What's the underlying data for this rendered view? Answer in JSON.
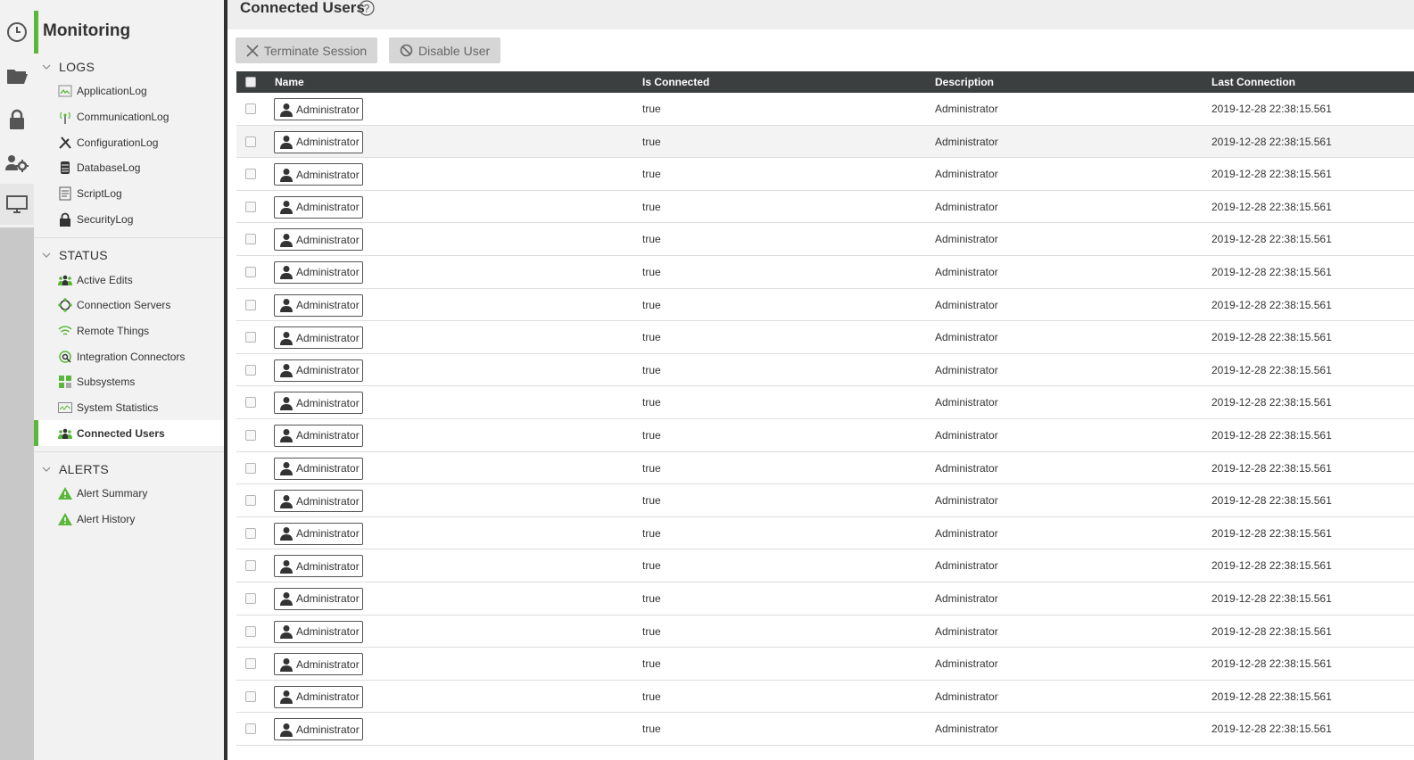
{
  "rail": {
    "icons": [
      "clock-icon",
      "folder-icon",
      "lock-icon",
      "users-gear-icon",
      "monitor-icon"
    ]
  },
  "sidebar": {
    "title": "Monitoring",
    "close": "×",
    "sections": [
      {
        "label": "LOGS",
        "items": [
          {
            "label": "ApplicationLog",
            "icon": "application-log-icon"
          },
          {
            "label": "CommunicationLog",
            "icon": "antenna-icon"
          },
          {
            "label": "ConfigurationLog",
            "icon": "tools-icon"
          },
          {
            "label": "DatabaseLog",
            "icon": "database-icon"
          },
          {
            "label": "ScriptLog",
            "icon": "script-icon"
          },
          {
            "label": "SecurityLog",
            "icon": "lock-icon"
          }
        ]
      },
      {
        "label": "STATUS",
        "items": [
          {
            "label": "Active Edits",
            "icon": "users-icon"
          },
          {
            "label": "Connection Servers",
            "icon": "connection-icon"
          },
          {
            "label": "Remote Things",
            "icon": "wifi-icon"
          },
          {
            "label": "Integration Connectors",
            "icon": "connector-icon"
          },
          {
            "label": "Subsystems",
            "icon": "subsystems-icon"
          },
          {
            "label": "System Statistics",
            "icon": "chart-icon"
          },
          {
            "label": "Connected Users",
            "icon": "users-icon",
            "selected": true
          }
        ]
      },
      {
        "label": "ALERTS",
        "items": [
          {
            "label": "Alert Summary",
            "icon": "warning-icon"
          },
          {
            "label": "Alert History",
            "icon": "warning-icon"
          }
        ]
      }
    ]
  },
  "main": {
    "title": "Connected Users",
    "help": "?",
    "toolbar": {
      "terminate_label": "Terminate Session",
      "disable_label": "Disable User"
    },
    "table": {
      "columns": [
        "Name",
        "Is Connected",
        "Description",
        "Last Connection"
      ],
      "rows": [
        {
          "name": "Administrator",
          "connected": "true",
          "description": "Administrator",
          "last": "2019-12-28 22:38:15.561"
        },
        {
          "name": "Administrator",
          "connected": "true",
          "description": "Administrator",
          "last": "2019-12-28 22:38:15.561"
        },
        {
          "name": "Administrator",
          "connected": "true",
          "description": "Administrator",
          "last": "2019-12-28 22:38:15.561"
        },
        {
          "name": "Administrator",
          "connected": "true",
          "description": "Administrator",
          "last": "2019-12-28 22:38:15.561"
        },
        {
          "name": "Administrator",
          "connected": "true",
          "description": "Administrator",
          "last": "2019-12-28 22:38:15.561"
        },
        {
          "name": "Administrator",
          "connected": "true",
          "description": "Administrator",
          "last": "2019-12-28 22:38:15.561"
        },
        {
          "name": "Administrator",
          "connected": "true",
          "description": "Administrator",
          "last": "2019-12-28 22:38:15.561"
        },
        {
          "name": "Administrator",
          "connected": "true",
          "description": "Administrator",
          "last": "2019-12-28 22:38:15.561"
        },
        {
          "name": "Administrator",
          "connected": "true",
          "description": "Administrator",
          "last": "2019-12-28 22:38:15.561"
        },
        {
          "name": "Administrator",
          "connected": "true",
          "description": "Administrator",
          "last": "2019-12-28 22:38:15.561"
        },
        {
          "name": "Administrator",
          "connected": "true",
          "description": "Administrator",
          "last": "2019-12-28 22:38:15.561"
        },
        {
          "name": "Administrator",
          "connected": "true",
          "description": "Administrator",
          "last": "2019-12-28 22:38:15.561"
        },
        {
          "name": "Administrator",
          "connected": "true",
          "description": "Administrator",
          "last": "2019-12-28 22:38:15.561"
        },
        {
          "name": "Administrator",
          "connected": "true",
          "description": "Administrator",
          "last": "2019-12-28 22:38:15.561"
        },
        {
          "name": "Administrator",
          "connected": "true",
          "description": "Administrator",
          "last": "2019-12-28 22:38:15.561"
        },
        {
          "name": "Administrator",
          "connected": "true",
          "description": "Administrator",
          "last": "2019-12-28 22:38:15.561"
        },
        {
          "name": "Administrator",
          "connected": "true",
          "description": "Administrator",
          "last": "2019-12-28 22:38:15.561"
        },
        {
          "name": "Administrator",
          "connected": "true",
          "description": "Administrator",
          "last": "2019-12-28 22:38:15.561"
        },
        {
          "name": "Administrator",
          "connected": "true",
          "description": "Administrator",
          "last": "2019-12-28 22:38:15.561"
        },
        {
          "name": "Administrator",
          "connected": "true",
          "description": "Administrator",
          "last": "2019-12-28 22:38:15.561"
        }
      ]
    }
  },
  "colors": {
    "accent": "#5bb73b",
    "header_bg": "#3b3f40",
    "sidebar_bg": "#f2f2f2",
    "rail_bg": "#c8c8c8"
  }
}
